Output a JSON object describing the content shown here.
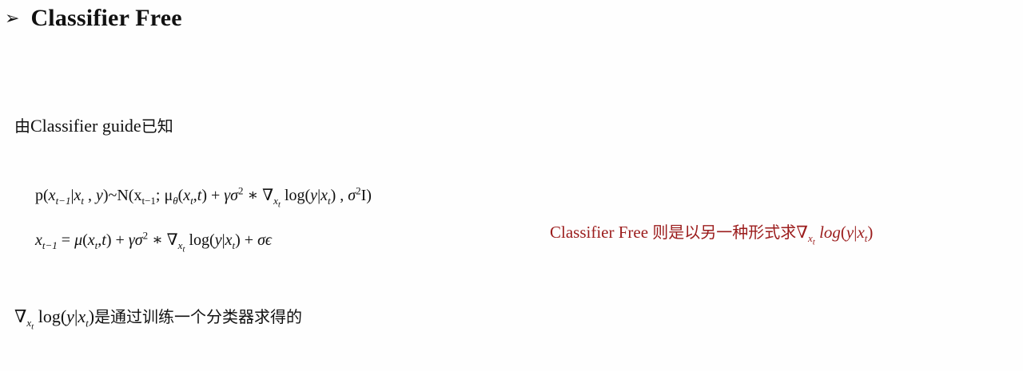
{
  "slide": {
    "bullet": "➢",
    "title": "Classifier Free",
    "intro": {
      "text": "Classifier guide",
      "cjk_prefix": "由",
      "cjk_suffix": "已知"
    },
    "eq1": "p(x_{t-1}|x_t , y)~N(x_{t-1}; μ_θ(x_t,t) + γσ^2 * ∇_{x_t} log(y|x_t) , σ^2 I)",
    "eq2": "x_{t-1} = μ(x_t,t) + γσ^2 * ∇_{x_t} log(y|x_t) + σϵ",
    "note": {
      "text": "Classifier Free",
      "cjk": "则是以另一种形式求",
      "formula": "∇_{x_t} log(y|x_t)"
    },
    "bottom": {
      "formula": "∇_{x_t} log(y|x_t)",
      "cjk": "是通过训练一个分类器求得的"
    }
  },
  "colors": {
    "note_color": "#9b1c1c",
    "text_color": "#111111"
  }
}
